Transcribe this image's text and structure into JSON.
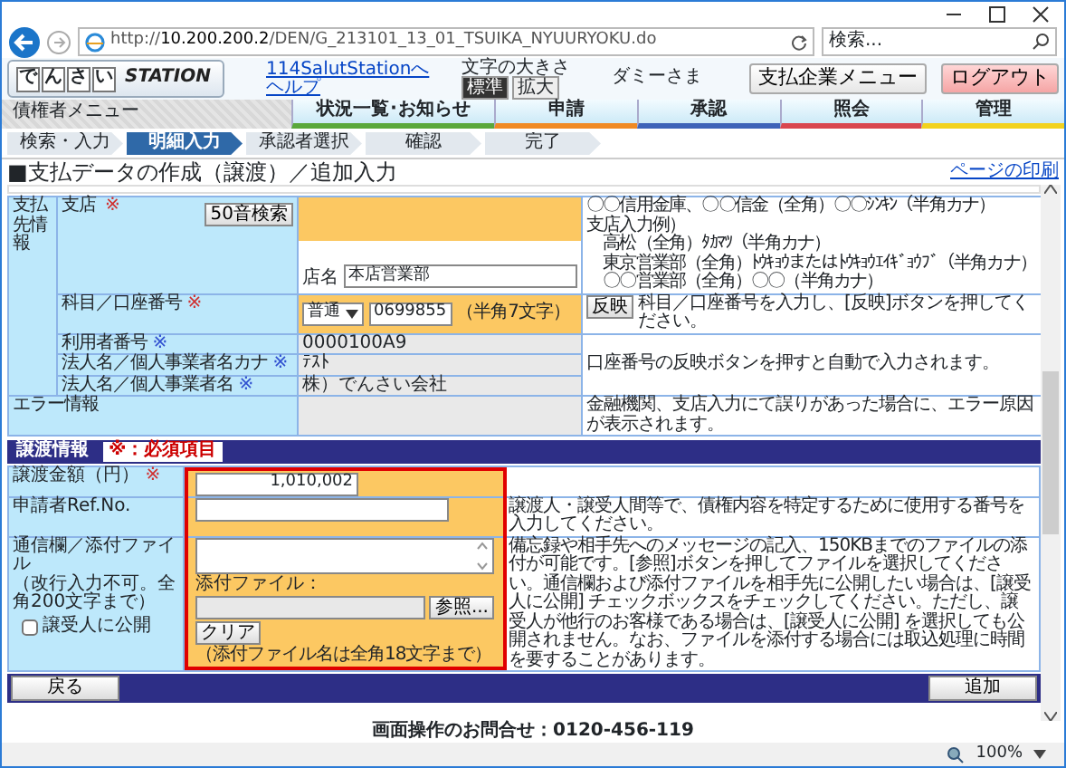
{
  "browser": {
    "address": "http://**10.200.200.2**/DEN/G_213101_13_01_TSUIKA_NYUURYOKU.do",
    "search_placeholder": "検索..."
  },
  "header": {
    "logo_chars": [
      "で",
      "ん",
      "さ",
      "い"
    ],
    "logo_text": "STATION",
    "links": [
      "114SalutStationへ",
      "ヘルプ"
    ],
    "font_size_label": "文字の大きさ",
    "font_sizes": [
      {
        "label": "標準",
        "selected": true
      },
      {
        "label": "拡大",
        "selected": false
      }
    ],
    "user": "ダミーさま",
    "buttons": [
      {
        "label": "支払企業メニュー",
        "kind": "menu"
      },
      {
        "label": "ログアウト",
        "kind": "logout"
      }
    ]
  },
  "nav": {
    "title": "債権者メニュー",
    "tabs": [
      {
        "label": "状況一覧･お知らせ",
        "color": "#5aa83c"
      },
      {
        "label": "申請",
        "color": "#f08a24"
      },
      {
        "label": "承認",
        "color": "#3d63b8"
      },
      {
        "label": "照会",
        "color": "#d9464f"
      },
      {
        "label": "管理",
        "color": "#f2d21e"
      }
    ]
  },
  "steps": [
    {
      "label": "検索・入力",
      "selected": false
    },
    {
      "label": "明細入力",
      "selected": true
    },
    {
      "label": "承認者選択",
      "selected": false
    },
    {
      "label": "確認",
      "selected": false
    },
    {
      "label": "完了",
      "selected": false
    }
  ],
  "page": {
    "title": "■支払データの作成（譲渡）／追加入力",
    "print_link": "ページの印刷"
  },
  "payee": {
    "label": "支払先情報",
    "branch": {
      "label": "支店",
      "mark": "※",
      "search_button": "50音検索",
      "name_label": "店名",
      "name_value": "本店営業部",
      "help": [
        "〇〇信用金庫、〇〇信金（全角）〇〇ｼﾝｷﾝ（半角カナ）",
        "支店入力例）",
        "　高松（全角）ﾀｶﾏﾂ（半角カナ）",
        "　東京営業部（全角）ﾄｳｷｮｳまたはﾄｳｷｮｳｴｲｷﾞｮｳﾌﾞ（半角カナ）",
        "　〇〇営業部（全角）〇〇（半角カナ）"
      ]
    },
    "account": {
      "label": "科目／口座番号",
      "mark": "※",
      "type": "普通",
      "number": "0699855",
      "note": "（半角7文字）",
      "apply_button": "反映",
      "help": "科目／口座番号を入力し、[反映]ボタンを押してください。"
    },
    "auto_rows": [
      {
        "label": "利用者番号",
        "mark": "※",
        "value": "0000100A9"
      },
      {
        "label": "法人名／個人事業者名カナ",
        "mark": "※",
        "value": "ﾃｽﾄ"
      },
      {
        "label": "法人名／個人事業者名",
        "mark": "※",
        "value": "株）でんさい会社"
      }
    ],
    "auto_help": "口座番号の反映ボタンを押すと自動で入力されます。",
    "error": {
      "label": "エラー情報",
      "help": "金融機関、支店入力にて誤りがあった場合に、エラー原因が表示されます。"
    }
  },
  "transfer": {
    "title": "譲渡情報",
    "badge": "※：必須項目",
    "highlighted": true,
    "amount": {
      "label": "譲渡金額（円）",
      "mark": "※",
      "value": "1,010,002"
    },
    "ref": {
      "label": "申請者Ref.No.",
      "help": "譲渡人・譲受人間等で、債権内容を特定するために使用する番号を入力してください。"
    },
    "message": {
      "label": "通信欄／添付ファイル",
      "sublabel": "（改行入力不可。全角200文字まで）",
      "public": {
        "label": "譲受人に公開",
        "checked": false
      },
      "file_label": "添付ファイル：",
      "browse_button": "参照...",
      "clear_button": "クリア",
      "file_note": "（添付ファイル名は全角18文字まで）",
      "help": "備忘録や相手先へのメッセージの記入、150KBまでのファイルの添付が可能です。[参照]ボタンを押してファイルを選択してください。通信欄および添付ファイルを相手先に公開したい場合は、[譲受人に公開] チェックボックスをチェックしてください。ただし、譲受人が他行のお客様である場合は、[譲受人に公開] を選択しても公開されません。なお、ファイルを添付する場合には取込処理に時間を要することがあります。"
    }
  },
  "footer_buttons": [
    {
      "label": "戻る",
      "kind": "back"
    },
    {
      "label": "追加",
      "kind": "add"
    }
  ],
  "contact": "画面操作のお問合せ：0120-456-119",
  "status_bar": {
    "zoom": "100%"
  }
}
